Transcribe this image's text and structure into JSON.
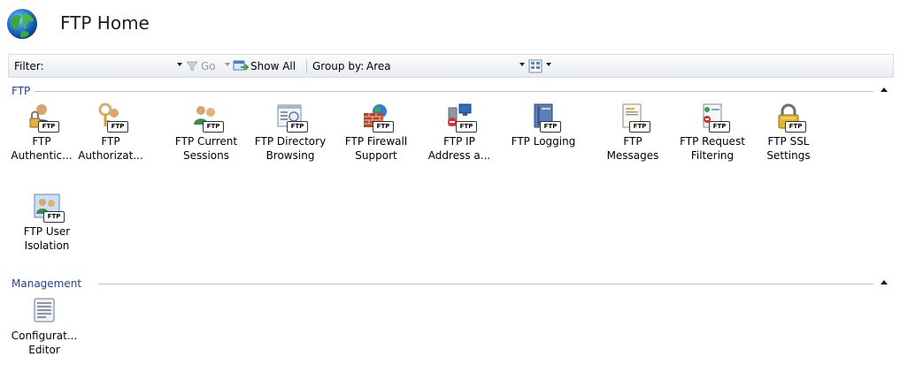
{
  "header": {
    "title": "FTP Home"
  },
  "toolbar": {
    "filter_label": "Filter:",
    "filter_value": "",
    "go_label": "Go",
    "show_all_label": "Show All",
    "group_by_label": "Group by:",
    "group_by_value": "Area"
  },
  "sections": {
    "ftp": {
      "label": "FTP",
      "items": [
        {
          "line1": "FTP",
          "line2": "Authentic...",
          "icon": "ftp-authentication-icon"
        },
        {
          "line1": "FTP",
          "line2": "Authorizat...",
          "icon": "ftp-authorization-icon"
        },
        {
          "line1": "FTP Current",
          "line2": "Sessions",
          "icon": "ftp-current-sessions-icon"
        },
        {
          "line1": "FTP Directory",
          "line2": "Browsing",
          "icon": "ftp-directory-browsing-icon"
        },
        {
          "line1": "FTP Firewall",
          "line2": "Support",
          "icon": "ftp-firewall-support-icon"
        },
        {
          "line1": "FTP IP",
          "line2": "Address a...",
          "icon": "ftp-ip-address-icon"
        },
        {
          "line1": "FTP Logging",
          "line2": "",
          "icon": "ftp-logging-icon"
        },
        {
          "line1": "FTP",
          "line2": "Messages",
          "icon": "ftp-messages-icon"
        },
        {
          "line1": "FTP Request",
          "line2": "Filtering",
          "icon": "ftp-request-filtering-icon"
        },
        {
          "line1": "FTP SSL",
          "line2": "Settings",
          "icon": "ftp-ssl-settings-icon"
        },
        {
          "line1": "FTP User",
          "line2": "Isolation",
          "icon": "ftp-user-isolation-icon"
        }
      ]
    },
    "management": {
      "label": "Management",
      "items": [
        {
          "line1": "Configurat...",
          "line2": "Editor",
          "icon": "configuration-editor-icon"
        }
      ]
    }
  },
  "icons": {
    "badge_text": "FTP"
  },
  "colors": {
    "section_label": "#2b3d8f",
    "accent_line": "#b5c3d8"
  }
}
